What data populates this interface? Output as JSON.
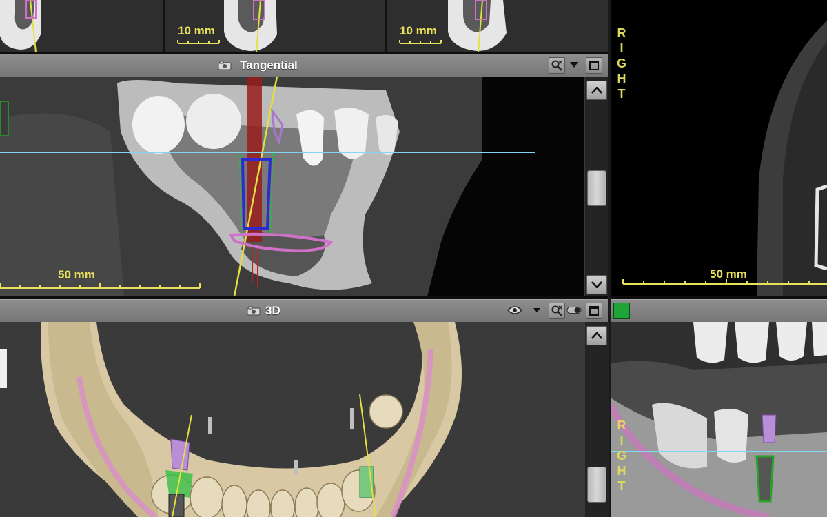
{
  "top_strip": {
    "scale_labels": [
      "10 mm",
      "10 mm"
    ]
  },
  "tangential": {
    "title": "Tangential",
    "scale_label": "50 mm"
  },
  "axial": {
    "orientation_label": "RIGHT",
    "scale_label": "50 mm"
  },
  "view3d": {
    "title": "3D"
  },
  "bottom_right": {
    "orientation_label": "RIGHT",
    "status_color": "#1fa43a"
  },
  "colors": {
    "scale": "#e8e05a",
    "guide_line": "#7fd8f0",
    "implant_axis": "#e3e040",
    "nerve_canal": "#d070c8"
  },
  "icons": [
    "camera-icon",
    "zoom-tool-icon",
    "dropdown-arrow-icon",
    "maximize-icon",
    "scroll-up-icon",
    "scroll-down-icon",
    "eye-icon",
    "toggle-icon"
  ]
}
